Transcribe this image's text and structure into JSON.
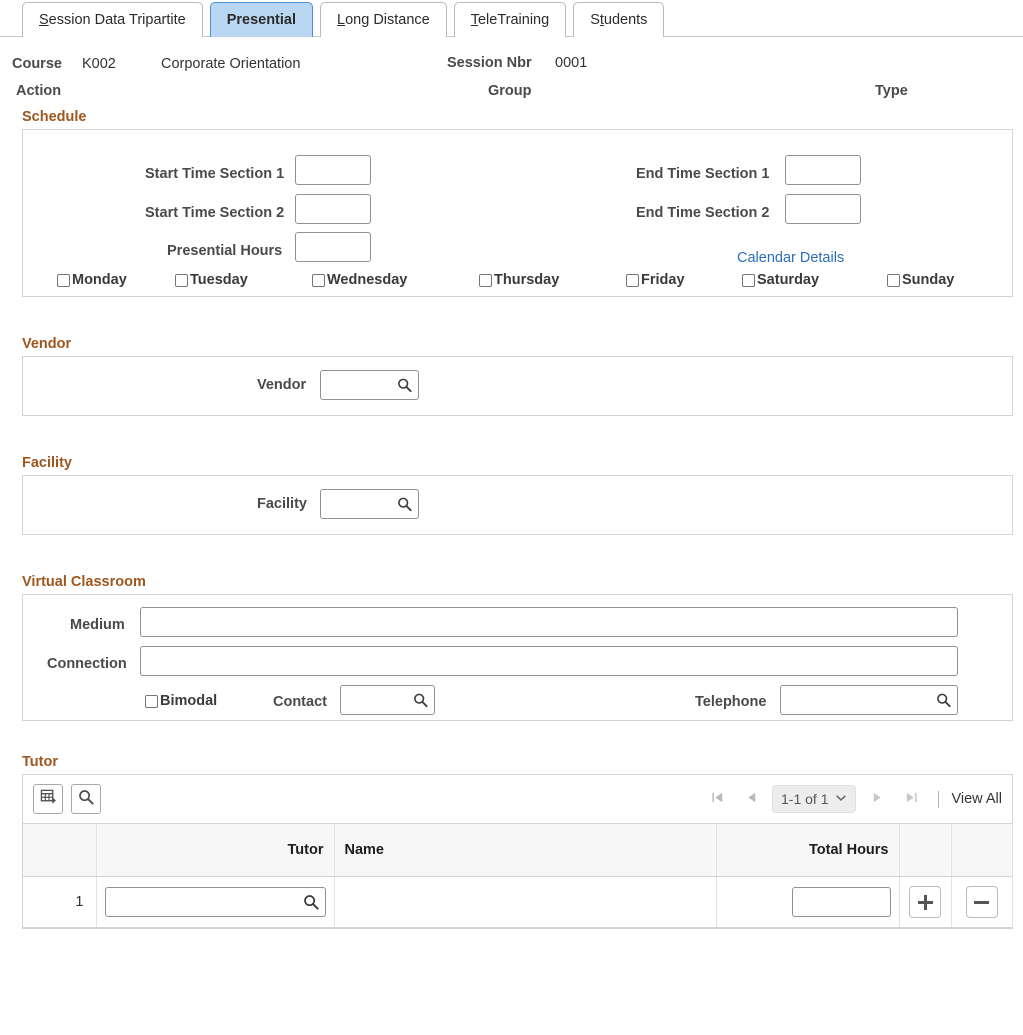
{
  "tabs": [
    {
      "label": "Session Data Tripartite",
      "accel_index": 0,
      "active": false
    },
    {
      "label": "Presential",
      "accel_index": -1,
      "active": true
    },
    {
      "label": "Long Distance",
      "accel_index": 0,
      "active": false
    },
    {
      "label": "TeleTraining",
      "accel_index": 0,
      "active": false
    },
    {
      "label": "Students",
      "accel_index": 1,
      "active": false
    }
  ],
  "header": {
    "course_label": "Course",
    "course_code": "K002",
    "course_name": "Corporate Orientation",
    "session_nbr_label": "Session Nbr",
    "session_nbr_value": "0001",
    "action_label": "Action",
    "action_value": "",
    "group_label": "Group",
    "group_value": "",
    "type_label": "Type",
    "type_value": ""
  },
  "schedule": {
    "title": "Schedule",
    "start_time_1_label": "Start Time Section 1",
    "start_time_1_value": "",
    "start_time_2_label": "Start Time Section 2",
    "start_time_2_value": "",
    "presential_hours_label": "Presential Hours",
    "presential_hours_value": "",
    "end_time_1_label": "End Time Section 1",
    "end_time_1_value": "",
    "end_time_2_label": "End Time Section 2",
    "end_time_2_value": "",
    "calendar_details_link": "Calendar Details",
    "days": [
      {
        "label": "Monday",
        "checked": false
      },
      {
        "label": "Tuesday",
        "checked": false
      },
      {
        "label": "Wednesday",
        "checked": false
      },
      {
        "label": "Thursday",
        "checked": false
      },
      {
        "label": "Friday",
        "checked": false
      },
      {
        "label": "Saturday",
        "checked": false
      },
      {
        "label": "Sunday",
        "checked": false
      }
    ]
  },
  "vendor": {
    "title": "Vendor",
    "field_label": "Vendor",
    "field_value": "",
    "lookup_icon": "magnifier-icon"
  },
  "facility": {
    "title": "Facility",
    "field_label": "Facility",
    "field_value": "",
    "lookup_icon": "magnifier-icon"
  },
  "virtual_classroom": {
    "title": "Virtual Classroom",
    "medium_label": "Medium",
    "medium_value": "",
    "connection_label": "Connection",
    "connection_value": "",
    "bimodal_label": "Bimodal",
    "bimodal_checked": false,
    "contact_label": "Contact",
    "contact_value": "",
    "telephone_label": "Telephone",
    "telephone_value": ""
  },
  "tutor": {
    "title": "Tutor",
    "toolbar": {
      "personalize_icon": "grid-personalize-icon",
      "find_icon": "magnifier-icon"
    },
    "pager": {
      "first_icon": "first-page-icon",
      "prev_icon": "previous-page-icon",
      "range_label": "1-1 of 1",
      "chevron_icon": "chevron-down-icon",
      "next_icon": "next-page-icon",
      "last_icon": "last-page-icon",
      "view_all_label": "View All"
    },
    "columns": [
      "",
      "Tutor",
      "Name",
      "Total Hours",
      "",
      ""
    ],
    "rows": [
      {
        "number": "1",
        "tutor": "",
        "name": "",
        "total_hours": "",
        "add_label": "+",
        "delete_label": "−"
      }
    ]
  },
  "colors": {
    "section_title": "#9e571f",
    "link": "#2a6ebb",
    "active_tab_bg": "#b9d7f2",
    "active_tab_border": "#4a90d9",
    "panel_border": "#ced6da",
    "input_border": "#8d9296"
  }
}
